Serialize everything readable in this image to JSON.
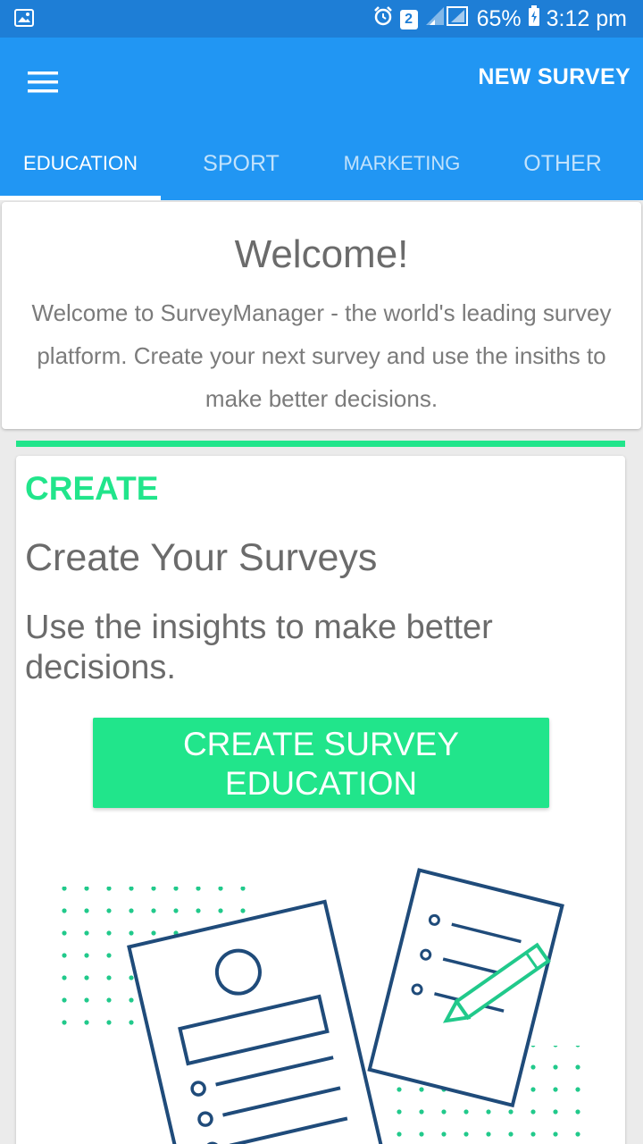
{
  "status_bar": {
    "battery": "65%",
    "time": "3:12 pm",
    "sim_badge": "2"
  },
  "app_bar": {
    "new_survey_label": "NEW SURVEY",
    "tabs": [
      {
        "label": "EDUCATION",
        "active": true
      },
      {
        "label": "SPORT",
        "active": false
      },
      {
        "label": "MARKETING",
        "active": false
      },
      {
        "label": "OTHER",
        "active": false
      }
    ]
  },
  "welcome": {
    "title": "Welcome!",
    "text": "Welcome to SurveyManager - the world's leading survey platform. Create your next survey and use the insiths to make better decisions."
  },
  "create": {
    "label": "CREATE",
    "heading": "Create Your Surveys",
    "text": "Use the insights to make better decisions.",
    "button_line1": "CREATE SURVEY",
    "button_line2": "EDUCATION"
  },
  "colors": {
    "primary": "#2196f3",
    "status_bar": "#1e7ed6",
    "accent_green": "#21e58b",
    "text_gray": "#6b6b6b",
    "illustration_line": "#1f4b7a"
  },
  "icons": [
    "image-icon",
    "alarm-icon",
    "signal-icon",
    "battery-icon",
    "menu-icon",
    "survey-illustration"
  ]
}
